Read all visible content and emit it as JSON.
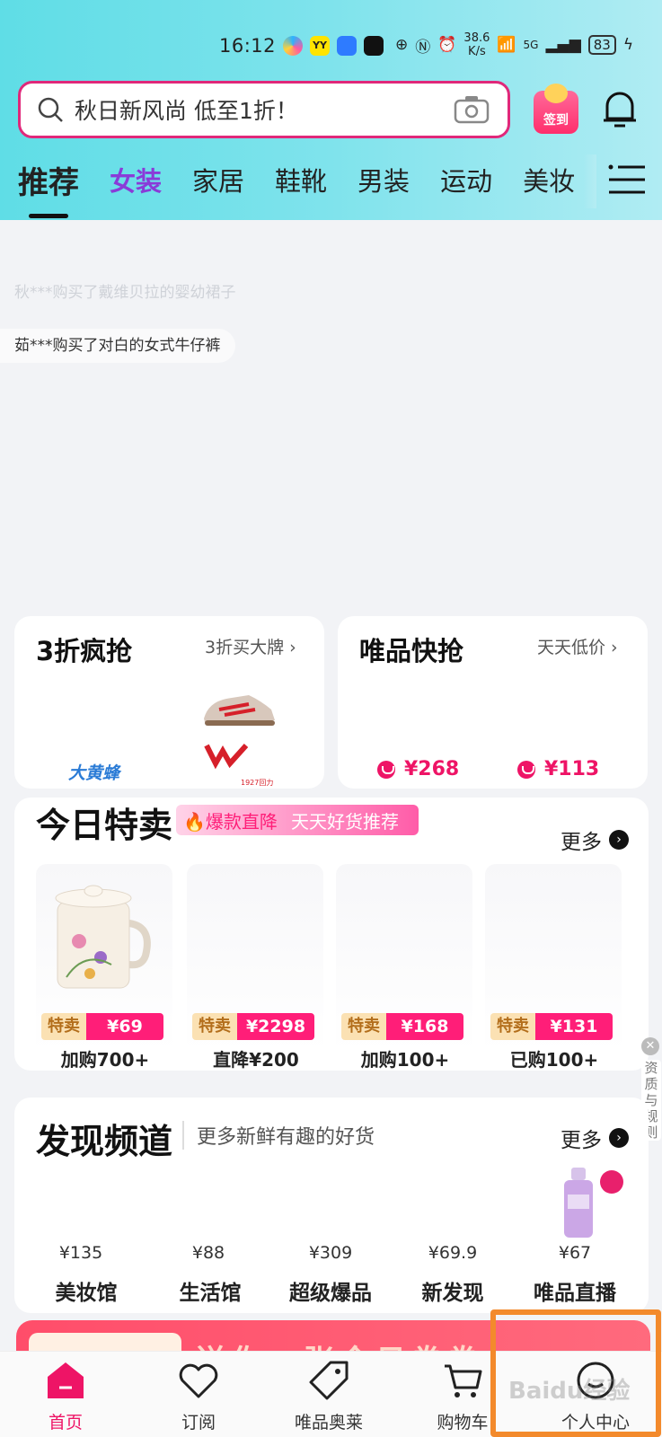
{
  "status_bar": {
    "time": "16:12",
    "speed": "38.6",
    "speed_unit": "K/s",
    "signal": "5G",
    "battery": "83"
  },
  "search": {
    "placeholder": "秋日新风尚 低至1折！",
    "signin_label": "签到"
  },
  "tabs": [
    {
      "label": "推荐",
      "active": true
    },
    {
      "label": "女装"
    },
    {
      "label": "家居"
    },
    {
      "label": "鞋靴"
    },
    {
      "label": "男装"
    },
    {
      "label": "运动"
    },
    {
      "label": "美妆"
    }
  ],
  "ticker": [
    "秋***购买了戴维贝拉的婴幼裙子",
    "茹***购买了对白的女式牛仔裤"
  ],
  "promo_cards": {
    "left": {
      "title": "3折疯抢",
      "link": "3折买大牌",
      "brand1": "大黄蜂",
      "brand2": "1927回力"
    },
    "right": {
      "title": "唯品快抢",
      "link": "天天低价",
      "prices": [
        "¥268",
        "¥113"
      ]
    }
  },
  "today_sale": {
    "title": "今日特卖",
    "badge1": "爆款直降",
    "badge2": "天天好货推荐",
    "more": "更多",
    "items": [
      {
        "tag": "特卖",
        "price": "¥69",
        "note": "加购700+"
      },
      {
        "tag": "特卖",
        "price": "¥2298",
        "note": "直降¥200"
      },
      {
        "tag": "特卖",
        "price": "¥168",
        "note": "加购100+"
      },
      {
        "tag": "特卖",
        "price": "¥131",
        "note": "已购100+"
      }
    ]
  },
  "discover": {
    "title": "发现频道",
    "subtitle": "更多新鲜有趣的好货",
    "more": "更多",
    "channels": [
      {
        "price": "¥135",
        "label": "美妆馆"
      },
      {
        "price": "¥88",
        "label": "生活馆"
      },
      {
        "price": "¥309",
        "label": "超级爆品"
      },
      {
        "price": "¥69.9",
        "label": "新发现"
      },
      {
        "price": "¥67",
        "label": "唯品直播"
      }
    ]
  },
  "side_badge": {
    "text": "资质与规则"
  },
  "banner": {
    "text": "送你一张今日券券"
  },
  "bottom_nav": [
    {
      "label": "首页",
      "active": true
    },
    {
      "label": "订阅"
    },
    {
      "label": "唯品奥莱"
    },
    {
      "label": "购物车"
    },
    {
      "label": "个人中心"
    }
  ],
  "colors": {
    "accent": "#ee1466",
    "header": "#5fdde6",
    "women_tab": "#8a3bd8",
    "highlight": "#f38a2c"
  },
  "watermark": "Baidu经验"
}
